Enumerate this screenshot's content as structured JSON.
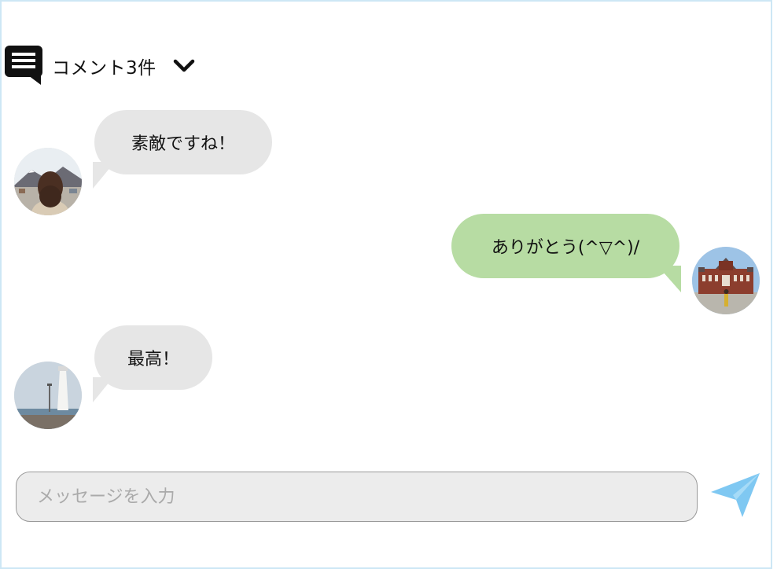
{
  "header": {
    "title": "コメント3件",
    "icon": "comment-list-icon",
    "toggle_icon": "chevron-down-icon"
  },
  "messages": [
    {
      "side": "left",
      "text": "素敵ですね！",
      "avatar": "avatar-woman-mountain"
    },
    {
      "side": "right",
      "text": "ありがとう(^▽^)/",
      "avatar": "avatar-station-building"
    },
    {
      "side": "left",
      "text": "最高！",
      "avatar": "avatar-lighthouse"
    }
  ],
  "composer": {
    "placeholder": "メッセージを入力",
    "send_icon": "send-icon"
  },
  "colors": {
    "left_bubble": "#e6e6e6",
    "right_bubble": "#b7dca3",
    "send": "#7fc8f2",
    "border": "#cde7f5"
  }
}
